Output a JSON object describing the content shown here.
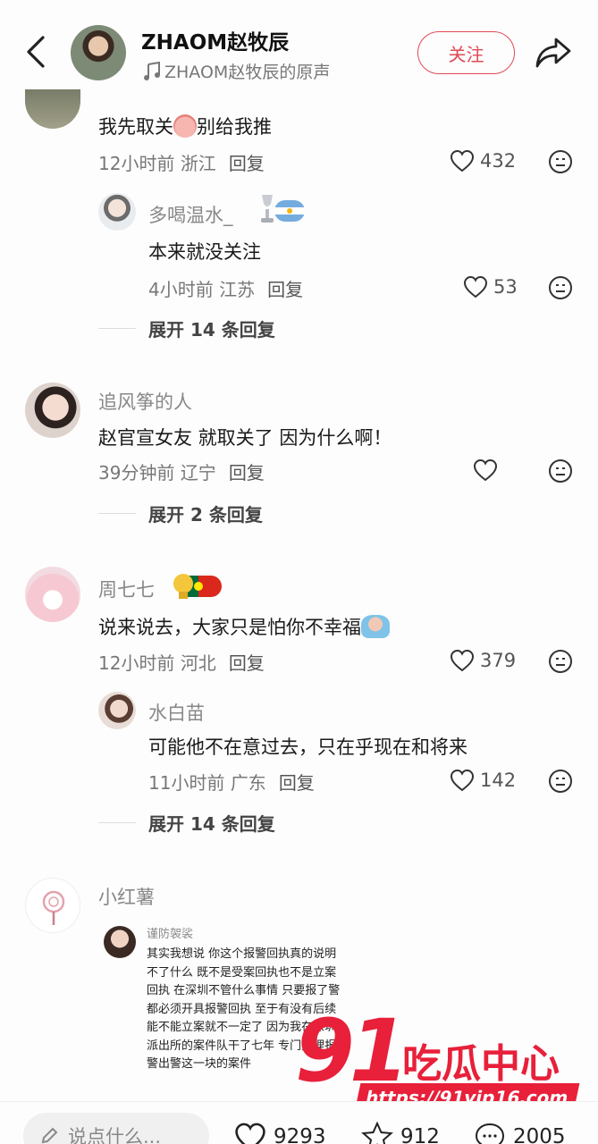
{
  "header": {
    "title": "ZHAOM赵牧辰",
    "audio_label": "ZHAOM赵牧辰的原声",
    "follow_label": "关注"
  },
  "comments": [
    {
      "text": "我先取关",
      "text_after_emoji": "别给我推",
      "time": "12小时前",
      "location": "浙江",
      "reply_label": "回复",
      "likes": "432",
      "replies": [
        {
          "name": "多喝温水_",
          "text": "本来就没关注",
          "time": "4小时前",
          "location": "江苏",
          "reply_label": "回复",
          "likes": "53"
        }
      ],
      "expand_label": "展开 14 条回复"
    },
    {
      "name": "追风筝的人",
      "text": "赵官宣女友 就取关了 因为什么啊！",
      "time": "39分钟前",
      "location": "辽宁",
      "reply_label": "回复",
      "likes": "",
      "expand_label": "展开 2 条回复"
    },
    {
      "name": "周七七",
      "text": "说来说去，大家只是怕你不幸福",
      "time": "12小时前",
      "location": "河北",
      "reply_label": "回复",
      "likes": "379",
      "replies": [
        {
          "name": "水白苗",
          "text": "可能他不在意过去，只在乎现在和将来",
          "time": "11小时前",
          "location": "广东",
          "reply_label": "回复",
          "likes": "142"
        }
      ],
      "expand_label": "展开 14 条回复"
    },
    {
      "name": "小红薯",
      "embedded": {
        "name": "谨防袈裟",
        "text": "其实我想说 你这个报警回执真的说明不了什么 既不是受案回执也不是立案回执 在深圳不管什么事情 只要报了警都必须开具报警回执 至于有没有后续能不能立案就不一定了 因为我在深圳派出所的案件队干了七年 专门处理报警出警这一块的案件"
      }
    }
  ],
  "watermark": {
    "number": "91",
    "text": "吃瓜中心",
    "url": "https://91vip16.com"
  },
  "bottom_bar": {
    "input_placeholder": "说点什么...",
    "likes": "9293",
    "favorites": "912",
    "comments": "2005"
  },
  "colors": {
    "accent": "#e04a55",
    "watermark": "#e8203a"
  }
}
